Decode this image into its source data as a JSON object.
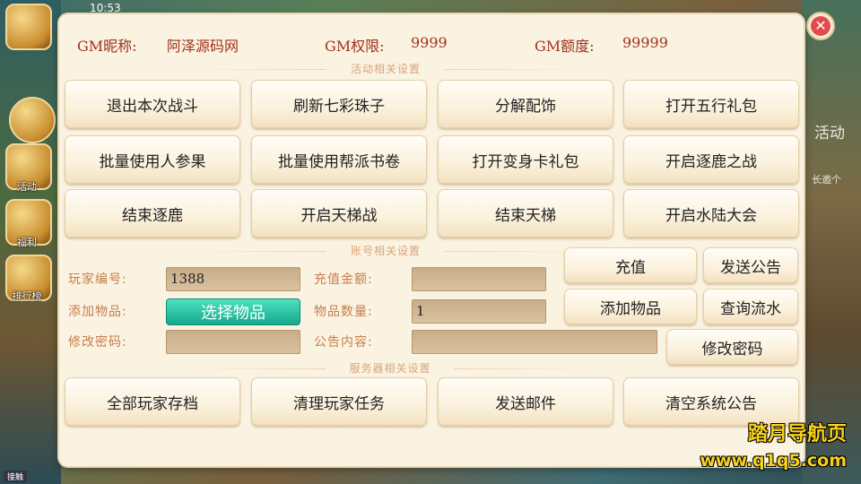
{
  "status_bar": {
    "time": "10:53"
  },
  "sidebar": {
    "items": [
      {
        "label": "活动",
        "icon": "gold-ingot-icon"
      },
      {
        "label": "福利",
        "icon": "gift-box-icon"
      },
      {
        "label": "排行榜",
        "icon": "ranking-icon"
      }
    ]
  },
  "right_side": {
    "activity_text": "活动",
    "invite_text": "长邀个"
  },
  "header": {
    "nickname_label": "GM昵称:",
    "nickname_value": "阿泽源码网",
    "permission_label": "GM权限:",
    "permission_value": "9999",
    "quota_label": "GM额度:",
    "quota_value": "99999"
  },
  "sections": {
    "activity": "活动相关设置",
    "account": "账号相关设置",
    "server": "服务器相关设置"
  },
  "activity_buttons": [
    "退出本次战斗",
    "刷新七彩珠子",
    "分解配饰",
    "打开五行礼包",
    "批量使用人参果",
    "批量使用帮派书卷",
    "打开变身卡礼包",
    "开启逐鹿之战",
    "结束逐鹿",
    "开启天梯战",
    "结束天梯",
    "开启水陆大会"
  ],
  "account": {
    "player_id_label": "玩家编号:",
    "player_id_value": "1388",
    "add_item_label": "添加物品:",
    "select_item_button": "选择物品",
    "change_pwd_label": "修改密码:",
    "change_pwd_value": "",
    "recharge_amount_label": "充值金额:",
    "recharge_amount_value": "",
    "item_count_label": "物品数量:",
    "item_count_value": "1",
    "notice_content_label": "公告内容:",
    "notice_content_value": "",
    "recharge_button": "充值",
    "send_notice_button": "发送公告",
    "add_item_button": "添加物品",
    "query_flow_button": "查询流水",
    "change_password_button": "修改密码"
  },
  "server_buttons": [
    "全部玩家存档",
    "清理玩家任务",
    "发送邮件",
    "清空系统公告"
  ],
  "watermark": {
    "line1": "踏月导航页",
    "line2": "www.q1q5.com"
  },
  "bottom_tag": "接触",
  "colors": {
    "accent_red": "#a0301c",
    "label_orange": "#c67d4d",
    "close_red": "#e34b4b",
    "pick_green": "#14a98c",
    "watermark_yellow": "#f7d21a"
  }
}
